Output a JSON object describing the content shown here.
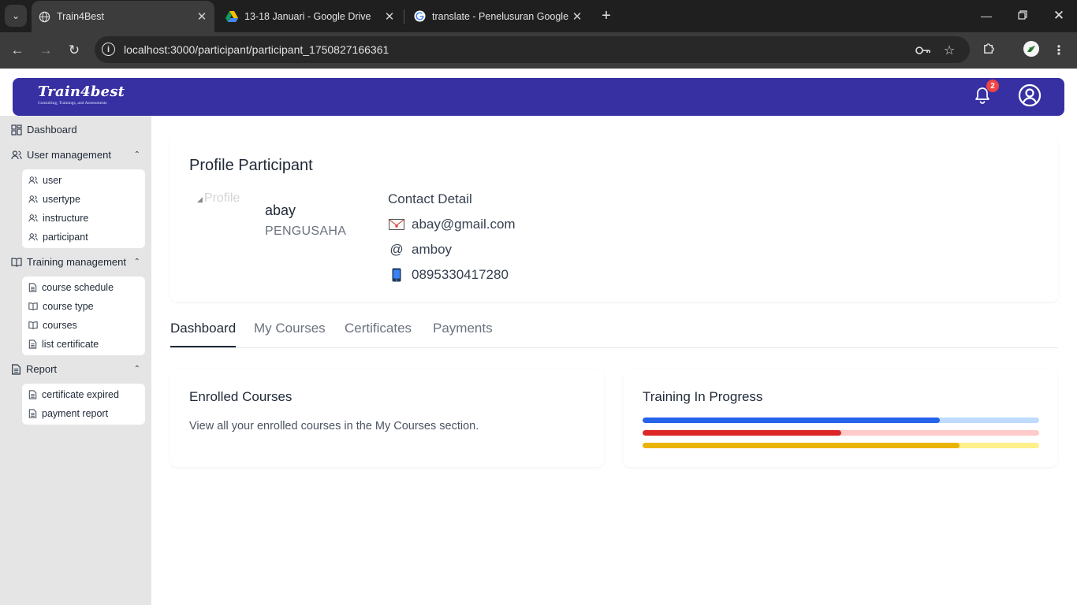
{
  "browser": {
    "tabs": [
      {
        "title": "Train4Best",
        "icon": "globe-icon",
        "active": true
      },
      {
        "title": "13-18 Januari - Google Drive",
        "icon": "google-drive-icon",
        "active": false
      },
      {
        "title": "translate - Penelusuran Google",
        "icon": "google-icon",
        "active": false
      }
    ],
    "url": "localhost:3000/participant/participant_1750827166361"
  },
  "app": {
    "brand": "Train4best",
    "tagline": "Consulting, Trainings, and Assessments",
    "notifications_count": "2",
    "colors": {
      "header": "#3730a3",
      "sidebar": "#e5e5e5",
      "badge": "#ef4444"
    }
  },
  "sidebar": {
    "dashboard": "Dashboard",
    "groups": [
      {
        "label": "User management",
        "items": [
          "user",
          "usertype",
          "instructure",
          "participant"
        ]
      },
      {
        "label": "Training management",
        "items": [
          "course schedule",
          "course type",
          "courses",
          "list certificate"
        ]
      },
      {
        "label": "Report",
        "items": [
          "certificate expired",
          "payment report"
        ]
      }
    ]
  },
  "profile": {
    "title": "Profile Participant",
    "image_alt": "Profile",
    "name": "abay",
    "role": "PENGUSAHA",
    "contact_heading": "Contact Detail",
    "email": "abay@gmail.com",
    "username_symbol": "@",
    "username": "amboy",
    "phone": "0895330417280"
  },
  "tabs": [
    "Dashboard",
    "My Courses",
    "Certificates",
    "Payments"
  ],
  "enrolled": {
    "title": "Enrolled Courses",
    "text": "View all your enrolled courses in the My Courses section."
  },
  "progress": {
    "title": "Training In Progress",
    "bars": [
      {
        "value": 0.75,
        "color": "#2563eb",
        "track": "#bfdbfe"
      },
      {
        "value": 0.5,
        "color": "#dc2626",
        "track": "#fecaca"
      },
      {
        "value": 0.8,
        "color": "#eab308",
        "track": "#fef08a"
      }
    ]
  }
}
